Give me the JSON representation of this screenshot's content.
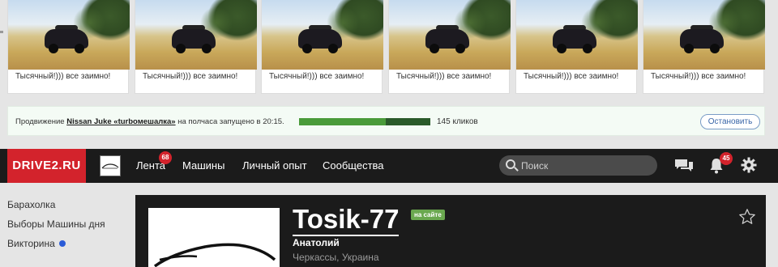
{
  "ads": {
    "items": [
      {
        "caption": "Тысячный!))) все заимно!"
      },
      {
        "caption": "Тысячный!))) все заимно!"
      },
      {
        "caption": "Тысячный!))) все заимно!"
      },
      {
        "caption": "Тысячный!))) все заимно!"
      },
      {
        "caption": "Тысячный!))) все заимно!"
      },
      {
        "caption": "Тысячный!))) все заимно!"
      }
    ]
  },
  "promo": {
    "prefix": "Продвижение ",
    "car_link": "Nissan Juke «turbомешалка»",
    "suffix": " на полчаса запущено в 20:15.",
    "progress_fraction": 0.66,
    "clicks": "145 кликов",
    "stop_label": "Остановить",
    "colors": {
      "bar_done": "#4a9b3a",
      "bar_rest": "#2a5a2a"
    }
  },
  "header": {
    "logo": "DRIVE2.RU",
    "nav": [
      {
        "label": "Лента",
        "badge": "68"
      },
      {
        "label": "Машины"
      },
      {
        "label": "Личный опыт"
      },
      {
        "label": "Сообщества"
      }
    ],
    "search_placeholder": "Поиск",
    "notifications_badge": "45",
    "icons": [
      "chat-icon",
      "bell-icon",
      "gear-icon"
    ],
    "colors": {
      "brand": "#d3232c",
      "bar": "#1b1b1b"
    }
  },
  "sidebar": {
    "items": [
      {
        "label": "Барахолка"
      },
      {
        "label": "Выборы Машины дня"
      },
      {
        "label": "Викторина",
        "dot": true
      }
    ]
  },
  "profile": {
    "username": "Tosik-77",
    "online_label": "на сайте",
    "real_name": "Анатолий",
    "city": "Черкассы, Украина"
  }
}
